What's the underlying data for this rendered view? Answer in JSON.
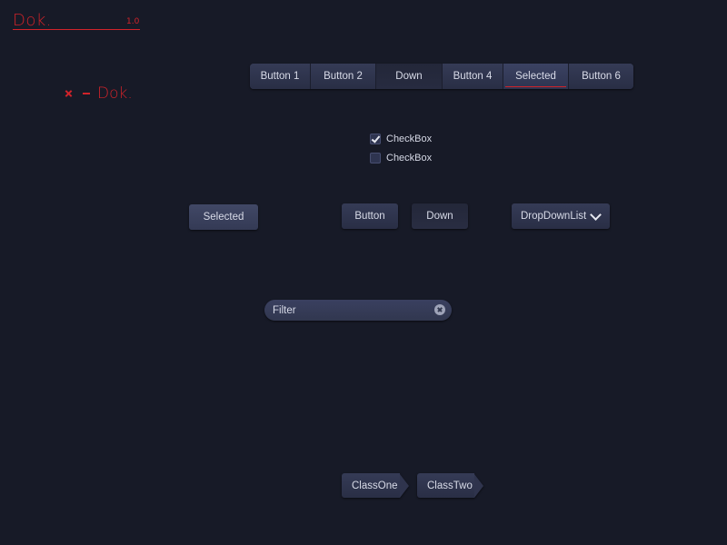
{
  "logo": {
    "title": "Dok.",
    "version": "1.0",
    "accent_color": "#d0232a"
  },
  "window_header": {
    "close_icon": "close-icon",
    "title": "Dok."
  },
  "segmented_bar": {
    "buttons": [
      {
        "label": "Button 1",
        "state": "normal"
      },
      {
        "label": "Button 2",
        "state": "normal"
      },
      {
        "label": "Down",
        "state": "down"
      },
      {
        "label": "Button 4",
        "state": "normal"
      },
      {
        "label": "Selected",
        "state": "selected"
      },
      {
        "label": "Button 6",
        "state": "normal"
      }
    ]
  },
  "checkboxes": [
    {
      "label": "CheckBox",
      "checked": true
    },
    {
      "label": "CheckBox",
      "checked": false
    }
  ],
  "buttons": {
    "selected_label": "Selected",
    "button_label": "Button",
    "down_label": "Down"
  },
  "dropdown": {
    "value": "DropDownList",
    "icon": "chevron-down-icon"
  },
  "filter": {
    "placeholder": "Filter",
    "value": "",
    "clear_icon": "clear-icon"
  },
  "class_tabs": [
    {
      "label": "ClassOne"
    },
    {
      "label": "ClassTwo"
    }
  ],
  "colors": {
    "background": "#171a27",
    "button": "#30354f",
    "text": "#d8dbe8"
  }
}
